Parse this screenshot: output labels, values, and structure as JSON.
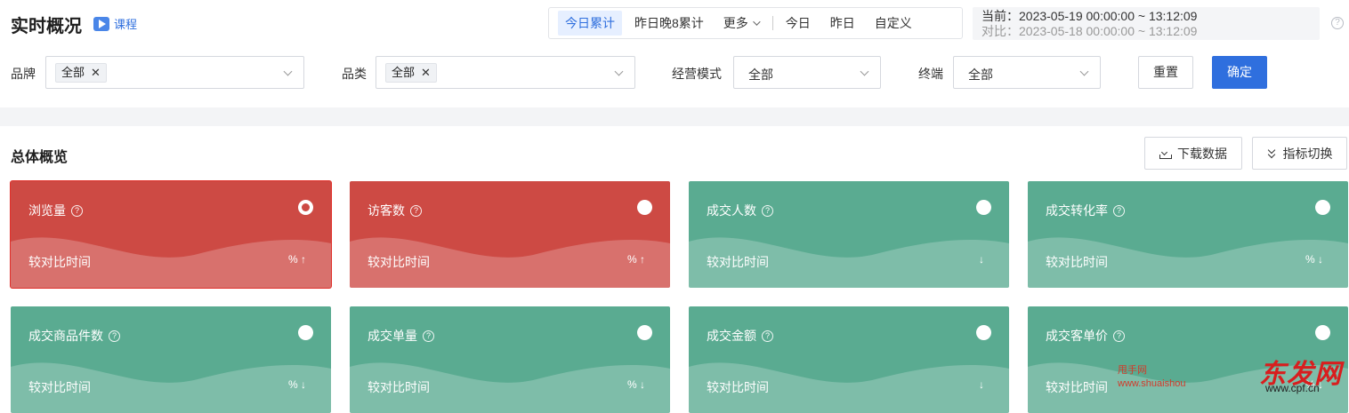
{
  "header": {
    "title": "实时概况",
    "course_label": "课程",
    "time_options": [
      "今日累计",
      "昨日晚8累计",
      "更多"
    ],
    "time_options_b": [
      "今日",
      "昨日",
      "自定义"
    ],
    "current_range": "当前：2023-05-19 00:00:00 ~ 13:12:09",
    "compare_range": "对比：2023-05-18 00:00:00 ~ 13:12:09",
    "help": "?"
  },
  "filters": {
    "brand_label": "品牌",
    "brand_tag": "全部",
    "category_label": "品类",
    "category_tag": "全部",
    "mode_label": "经营模式",
    "mode_value": "全部",
    "terminal_label": "终端",
    "terminal_value": "全部",
    "reset_label": "重置",
    "confirm_label": "确定",
    "tag_remove": "✕"
  },
  "overview": {
    "title": "总体概览",
    "download_label": "下载数据",
    "switch_label": "指标切换",
    "compare_label": "较对比时间",
    "cards": [
      {
        "name": "浏览量",
        "trend": "% ↑",
        "color": "red",
        "selected": true
      },
      {
        "name": "访客数",
        "trend": "% ↑",
        "color": "red",
        "selected": false
      },
      {
        "name": "成交人数",
        "trend": "↓",
        "color": "green",
        "selected": false
      },
      {
        "name": "成交转化率",
        "trend": "% ↓",
        "color": "green",
        "selected": false
      },
      {
        "name": "成交商品件数",
        "trend": "% ↓",
        "color": "green",
        "selected": false
      },
      {
        "name": "成交单量",
        "trend": "% ↓",
        "color": "green",
        "selected": false
      },
      {
        "name": "成交金额",
        "trend": "↓",
        "color": "green",
        "selected": false
      },
      {
        "name": "成交客单价",
        "trend": "% ↓",
        "color": "green",
        "selected": false
      }
    ]
  },
  "watermark": {
    "line1": "甩手网",
    "line2": "www.shuaishou",
    "brand": "东发网",
    "domain": "www.cpf.cn"
  },
  "colors": {
    "accent": "#2f6fde",
    "up": "#cd4a44",
    "down": "#5aab91"
  }
}
